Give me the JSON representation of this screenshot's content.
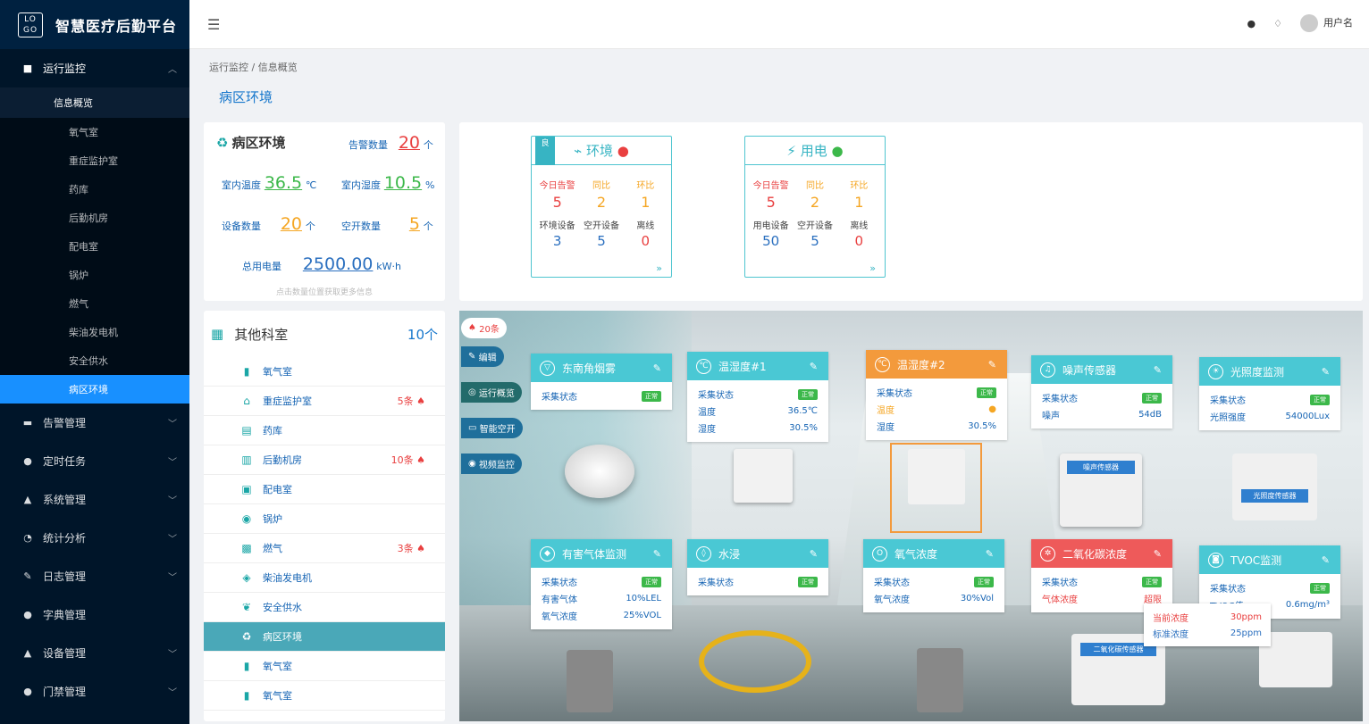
{
  "app": {
    "logo": "LO GO",
    "title": "智慧医疗后勤平台"
  },
  "header": {
    "user": "用户名"
  },
  "breadcrumb": "运行监控 / 信息概览",
  "page_title": "病区环境",
  "sidebar": {
    "group": "运行监控",
    "overview": "信息概览",
    "sub_items": [
      "氧气室",
      "重症监护室",
      "药库",
      "后勤机房",
      "配电室",
      "锅炉",
      "燃气",
      "柴油发电机",
      "安全供水",
      "病区环境"
    ],
    "menus": [
      "告警管理",
      "定时任务",
      "系统管理",
      "统计分析",
      "日志管理",
      "字典管理",
      "设备管理",
      "门禁管理"
    ]
  },
  "ward": {
    "title": "病区环境",
    "alarm_label": "告警数量",
    "alarm_value": "20",
    "alarm_unit": "个",
    "temp_label": "室内温度",
    "temp_value": "36.5",
    "temp_unit": "℃",
    "hum_label": "室内湿度",
    "hum_value": "10.5",
    "hum_unit": "%",
    "dev_label": "设备数量",
    "dev_value": "20",
    "dev_unit": "个",
    "sw_label": "空开数量",
    "sw_value": "5",
    "sw_unit": "个",
    "power_label": "总用电量",
    "power_value": "2500.00",
    "power_unit": "kW·h",
    "hint": "点击数量位置获取更多信息"
  },
  "env_panel": {
    "badge": "良",
    "title": "环境",
    "h1": "今日告警",
    "h2": "同比",
    "h3": "环比",
    "v1": "5",
    "v2": "2",
    "v3": "1",
    "l1": "环境设备",
    "l2": "空开设备",
    "l3": "离线",
    "w1": "3",
    "w2": "5",
    "w3": "0"
  },
  "power_panel": {
    "title": "用电",
    "h1": "今日告警",
    "h2": "同比",
    "h3": "环比",
    "v1": "5",
    "v2": "2",
    "v3": "1",
    "l1": "用电设备",
    "l2": "空开设备",
    "l3": "离线",
    "w1": "50",
    "w2": "5",
    "w3": "0"
  },
  "depts": {
    "title": "其他科室",
    "count": "10个",
    "items": [
      {
        "name": "氧气室",
        "alarm": ""
      },
      {
        "name": "重症监护室",
        "alarm": "5条"
      },
      {
        "name": "药库",
        "alarm": ""
      },
      {
        "name": "后勤机房",
        "alarm": "10条"
      },
      {
        "name": "配电室",
        "alarm": ""
      },
      {
        "name": "锅炉",
        "alarm": ""
      },
      {
        "name": "燃气",
        "alarm": "3条"
      },
      {
        "name": "柴油发电机",
        "alarm": ""
      },
      {
        "name": "安全供水",
        "alarm": ""
      },
      {
        "name": "病区环境",
        "alarm": ""
      },
      {
        "name": "氧气室",
        "alarm": ""
      },
      {
        "name": "氧气室",
        "alarm": ""
      }
    ]
  },
  "scene": {
    "alarm_pill": "20条",
    "buttons": [
      "编辑",
      "运行概览",
      "智能空开",
      "视频监控"
    ],
    "status_label": "采集状态",
    "ok": "正常",
    "smoke": {
      "title": "东南角烟雾"
    },
    "th1": {
      "title": "温湿度#1",
      "t_label": "温度",
      "t": "36.5℃",
      "h_label": "湿度",
      "h": "30.5%"
    },
    "th2": {
      "title": "温湿度#2",
      "t_label": "温度",
      "h_label": "湿度",
      "h": "30.5%"
    },
    "noise": {
      "title": "噪声传感器",
      "label": "噪声",
      "value": "54dB",
      "device": "噪声传感器"
    },
    "light": {
      "title": "光照度监测",
      "label": "光照强度",
      "value": "54000Lux",
      "device": "光照度传感器"
    },
    "gas": {
      "title": "有害气体监测",
      "l1": "有害气体",
      "v1": "10%LEL",
      "l2": "氧气浓度",
      "v2": "25%VOL"
    },
    "water": {
      "title": "水浸"
    },
    "oxygen": {
      "title": "氧气浓度",
      "label": "氧气浓度",
      "value": "30%Vol"
    },
    "co2": {
      "title": "二氧化碳浓度",
      "label": "气体浓度",
      "value": "超限",
      "device": "二氧化碳传感器"
    },
    "tvoc": {
      "title": "TVOC监测",
      "label": "TVOC值",
      "value": "0.6mg/m³"
    },
    "tip": {
      "l1": "当前浓度",
      "v1": "30ppm",
      "l2": "标准浓度",
      "v2": "25ppm"
    }
  }
}
